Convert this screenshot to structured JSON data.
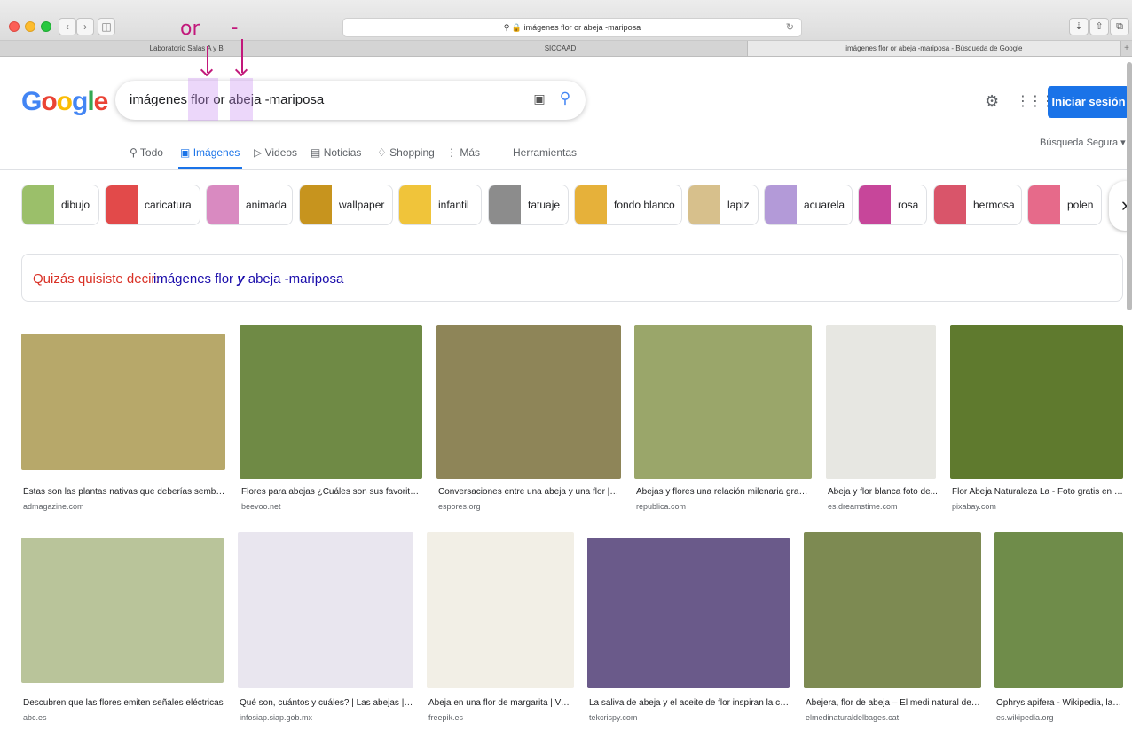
{
  "browser": {
    "address": "imágenes flor or abeja -mariposa",
    "tabs": [
      {
        "label": "Laboratorio Salas A y B"
      },
      {
        "label": "SICCAAD"
      },
      {
        "label": "imágenes flor or abeja -mariposa - Búsqueda de Google"
      }
    ]
  },
  "annotations": {
    "or": "or",
    "dash": "-"
  },
  "google": {
    "logo": [
      "G",
      "o",
      "o",
      "g",
      "l",
      "e"
    ],
    "query": "imágenes flor or abeja -mariposa",
    "signin": "Iniciar sesión",
    "safe_search": "Búsqueda Segura ▾",
    "nav": [
      {
        "label": "Todo",
        "icon": "search-icon"
      },
      {
        "label": "Imágenes",
        "icon": "image-icon"
      },
      {
        "label": "Videos",
        "icon": "video-icon"
      },
      {
        "label": "Noticias",
        "icon": "news-icon"
      },
      {
        "label": "Shopping",
        "icon": "tag-icon"
      },
      {
        "label": "Más",
        "icon": "more-vert-icon"
      },
      {
        "label": "Herramientas"
      }
    ],
    "chips": [
      {
        "label": "dibujo",
        "color": "#9bbf6a"
      },
      {
        "label": "caricatura",
        "color": "#e24a4a"
      },
      {
        "label": "animada",
        "color": "#d98ac1"
      },
      {
        "label": "wallpaper",
        "color": "#c7941e"
      },
      {
        "label": "infantil",
        "color": "#f0c43a"
      },
      {
        "label": "tatuaje",
        "color": "#8c8c8c"
      },
      {
        "label": "fondo blanco",
        "color": "#e6b13a"
      },
      {
        "label": "lapiz",
        "color": "#d7c08c"
      },
      {
        "label": "acuarela",
        "color": "#b39ad8"
      },
      {
        "label": "rosa",
        "color": "#c7469a"
      },
      {
        "label": "hermosa",
        "color": "#d9556a"
      },
      {
        "label": "polen",
        "color": "#e66a8a"
      }
    ],
    "did_you_mean": {
      "prefix": "Quizás quisiste decir:",
      "before": "imágenes flor",
      "bold": "y",
      "after": "abeja -mariposa"
    },
    "results_row1": [
      {
        "title": "Éstas son las plantas nativas que deberías sembra...",
        "source": "admagazine.com",
        "bg": "#b7a86a"
      },
      {
        "title": "Flores para abejas ¿Cuáles son sus favoritas...",
        "source": "beevoo.net",
        "bg": "#6f8a45"
      },
      {
        "title": "Conversaciones entre una abeja y una flor | Es...",
        "source": "espores.org",
        "bg": "#8e8558"
      },
      {
        "title": "Abejas y flores una relación milenaria graci...",
        "source": "republica.com",
        "bg": "#9aa66a"
      },
      {
        "title": "Abeja y flor blanca foto de...",
        "source": "es.dreamstime.com",
        "bg": "#e7e7e2"
      },
      {
        "title": "Flor Abeja Naturaleza La - Foto gratis en Pi...",
        "source": "pixabay.com",
        "bg": "#5f7a2e"
      }
    ],
    "results_row2": [
      {
        "title": "Descubren que las flores emiten señales eléctricas",
        "source": "abc.es",
        "bg": "#b9c49a"
      },
      {
        "title": "Qué son, cuántos y cuáles? | Las abejas | Sl...",
        "source": "infosiap.siap.gob.mx",
        "bg": "#e9e6ef"
      },
      {
        "title": "Abeja en una flor de margarita | Vec...",
        "source": "freepik.es",
        "bg": "#f2efe6"
      },
      {
        "title": "La saliva de abeja y el aceite de flor inspiran la cre...",
        "source": "tekcrispy.com",
        "bg": "#6a5a8a"
      },
      {
        "title": "Abejera, flor de abeja – El medi natural del ...",
        "source": "elmedinaturaldelbages.cat",
        "bg": "#7d8a52"
      },
      {
        "title": "Ophrys apifera - Wikipedia, la e...",
        "source": "es.wikipedia.org",
        "bg": "#6f8c4a"
      }
    ]
  }
}
